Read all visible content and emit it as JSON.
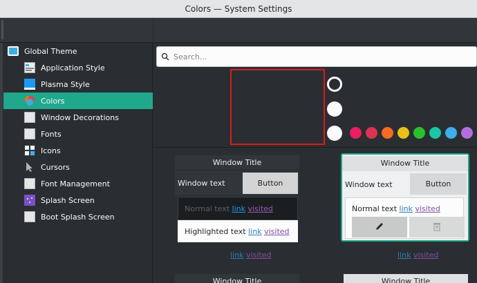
{
  "window": {
    "title": "Colors — System Settings"
  },
  "sidebar": {
    "items": [
      {
        "label": "Global Theme",
        "icon": "global-theme-icon"
      },
      {
        "label": "Application Style",
        "icon": "application-style-icon"
      },
      {
        "label": "Plasma Style",
        "icon": "plasma-style-icon"
      },
      {
        "label": "Colors",
        "icon": "colors-icon",
        "active": true
      },
      {
        "label": "Window Decorations",
        "icon": "window-decorations-icon"
      },
      {
        "label": "Fonts",
        "icon": "fonts-icon"
      },
      {
        "label": "Icons",
        "icon": "icons-icon"
      },
      {
        "label": "Cursors",
        "icon": "cursors-icon"
      },
      {
        "label": "Font Management",
        "icon": "font-management-icon"
      },
      {
        "label": "Splash Screen",
        "icon": "splash-screen-icon"
      },
      {
        "label": "Boot Splash Screen",
        "icon": "boot-splash-screen-icon"
      }
    ]
  },
  "main": {
    "search": {
      "placeholder": "Search..."
    },
    "accent_swatches": [
      "#e91e63",
      "#da3450",
      "#f46b25",
      "#e8c116",
      "#27c12a",
      "#1bc6a4",
      "#3daee9",
      "#b36fe0"
    ],
    "schemes": [
      {
        "window_title": "Window Title",
        "window_text": "Window text",
        "button": "Button",
        "normal_text": "Normal text",
        "link": "link",
        "visited": "visited",
        "highlighted_text": "Highlighted text",
        "footer_link": "link",
        "footer_visited": "visited"
      },
      {
        "window_title": "Window Title",
        "window_text": "Window text",
        "button": "Button",
        "normal_text": "Normal text",
        "link": "link",
        "visited": "visited",
        "footer_link": "link",
        "footer_visited": "visited"
      }
    ],
    "lower_cards": [
      {
        "window_title": "Window Title"
      },
      {
        "window_title": "Window Title"
      }
    ]
  },
  "colors": {
    "accent": "#1fa88c",
    "highlight_border": "#da1c1c"
  }
}
